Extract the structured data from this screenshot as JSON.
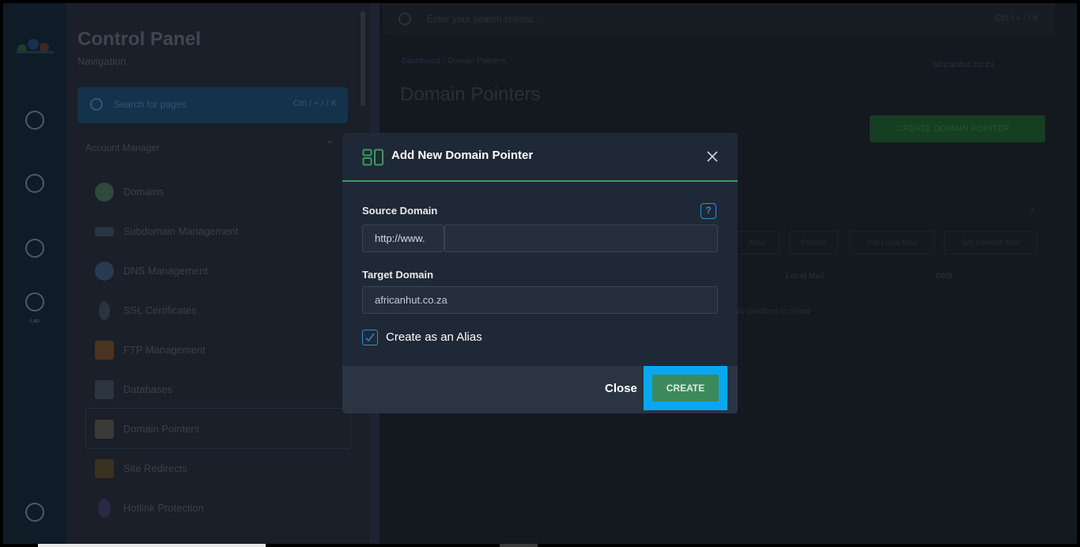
{
  "background": {
    "sidebar": {
      "title": "Control Panel",
      "subtitle": "Navigation",
      "search_placeholder": "Search for pages",
      "search_shortcut": "Ctrl / + / / K",
      "section": "Account Manager",
      "items": [
        {
          "label": "Domains",
          "icon": "globe-icon"
        },
        {
          "label": "Subdomain Management",
          "icon": "subdomain-icon"
        },
        {
          "label": "DNS Management",
          "icon": "dns-icon"
        },
        {
          "label": "SSL Certificates",
          "icon": "ssl-icon"
        },
        {
          "label": "FTP Management",
          "icon": "ftp-icon"
        },
        {
          "label": "Databases",
          "icon": "database-icon"
        },
        {
          "label": "Domain Pointers",
          "icon": "pointer-icon"
        },
        {
          "label": "Site Redirects",
          "icon": "redirect-icon"
        },
        {
          "label": "Hotlink Protection",
          "icon": "hotlink-icon"
        }
      ],
      "rail_label": "Lab"
    },
    "topbar": {
      "placeholder": "Enter your search criteria...",
      "shortcut": "Ctrl / + / / K"
    },
    "breadcrumb": {
      "home": "Dashboard",
      "current": "Domain Pointers"
    },
    "page_title": "Domain Pointers",
    "domain_selector": "africanhut.co.za",
    "create_button": "CREATE DOMAIN POINTER",
    "tabs": [
      "Alias",
      "Pointer",
      "Set Local Mail",
      "Set Remote Mail"
    ],
    "columns": [
      "Local Mail",
      "DNS"
    ],
    "empty_row": "No pointers to show"
  },
  "modal": {
    "title": "Add New Domain Pointer",
    "source_label": "Source Domain",
    "help_glyph": "?",
    "source_prefix": "http://www.",
    "source_value": "",
    "target_label": "Target Domain",
    "target_value": "africanhut.co.za",
    "alias_checked": true,
    "alias_label": "Create as an Alias",
    "close_label": "Close",
    "create_label": "CREATE"
  },
  "colors": {
    "accent_green": "#3d9a60",
    "accent_blue": "#2d8fd6",
    "highlight": "#0aa7f0",
    "modal_bg": "#1f2836"
  }
}
